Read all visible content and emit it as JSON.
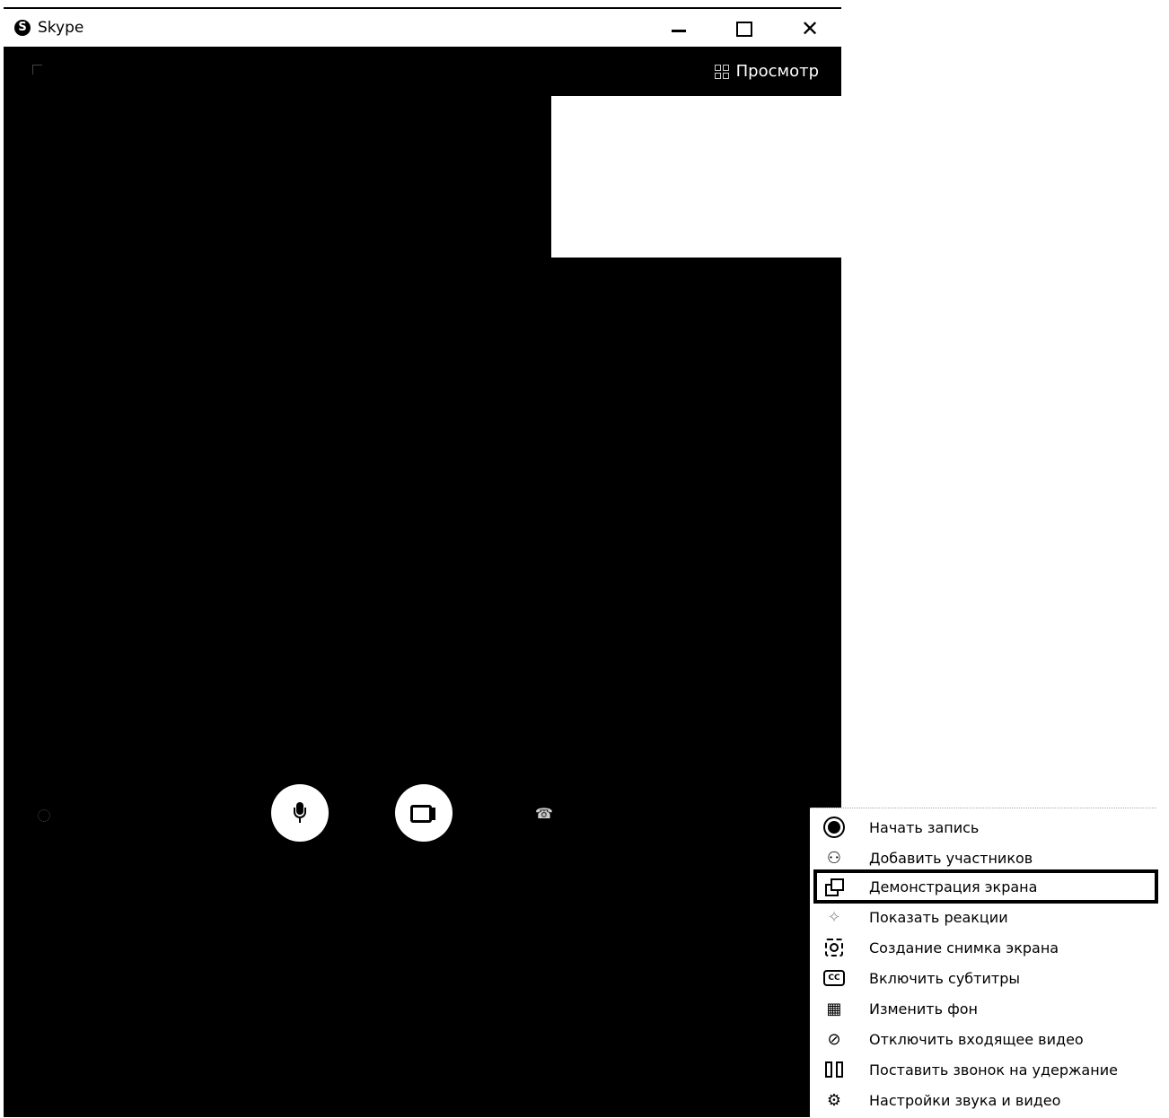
{
  "window": {
    "title": "Skype",
    "logo_letter": "S",
    "close_glyph": "✕"
  },
  "call": {
    "view_toggle_label": "Просмотр",
    "hangup_glyph": "☎"
  },
  "context_menu": {
    "items": [
      {
        "icon": "record-icon",
        "label": "Начать запись"
      },
      {
        "icon": "add-person-icon",
        "label": "Добавить участников",
        "glyph": "⚇"
      },
      {
        "icon": "screen-share-icon",
        "label": "Демонстрация экрана"
      },
      {
        "icon": "reactions-icon",
        "label": "Показать реакции",
        "glyph": "✧"
      },
      {
        "icon": "snapshot-icon",
        "label": "Создание снимка экрана"
      },
      {
        "icon": "subtitles-icon",
        "label": "Включить субтитры",
        "glyph": "CC"
      },
      {
        "icon": "background-icon",
        "label": "Изменить фон",
        "glyph": "▦"
      },
      {
        "icon": "video-off-icon",
        "label": "Отключить входящее видео",
        "glyph": "⊘"
      },
      {
        "icon": "hold-icon",
        "label": "Поставить звонок на удержание"
      },
      {
        "icon": "settings-gear-icon",
        "label": "Настройки звука и видео",
        "glyph": "⚙"
      }
    ]
  }
}
